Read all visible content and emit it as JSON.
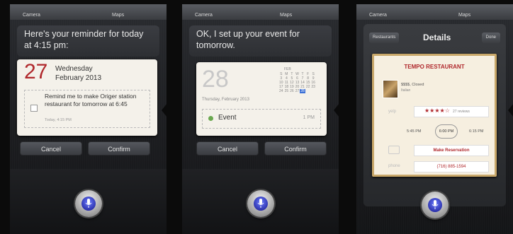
{
  "panels": [
    {
      "top_left": "Camera",
      "top_right": "Maps",
      "bubble": "Here's your reminder for today at 4:15 pm:",
      "card": {
        "day": "27",
        "weekday": "Wednesday",
        "month_year": "February 2013",
        "reminder_text": "Remind me to make Origer station restaurant for tomorrow at 6:45",
        "reminder_time": "Today, 4:15 PM"
      },
      "cancel": "Cancel",
      "confirm": "Confirm"
    },
    {
      "top_left": "Camera",
      "top_right": "Maps",
      "bubble": "OK, I set up your event for tomorrow.",
      "card": {
        "day": "28",
        "date_line": "Thursday, February 2013",
        "month_abbr": "FEB",
        "cal_header": [
          "S",
          "M",
          "T",
          "W",
          "T",
          "F",
          "S"
        ],
        "cal_rows": [
          [
            "3",
            "4",
            "5",
            "6",
            "7",
            "8",
            "9"
          ],
          [
            "10",
            "11",
            "12",
            "13",
            "14",
            "15",
            "16"
          ],
          [
            "17",
            "18",
            "19",
            "20",
            "21",
            "22",
            "23"
          ],
          [
            "24",
            "25",
            "26",
            "27",
            "28",
            "",
            ""
          ]
        ],
        "event_name": "Event",
        "event_time": "1 PM"
      },
      "cancel": "Cancel",
      "confirm": "Confirm"
    },
    {
      "top_left": "Camera",
      "top_right": "Maps",
      "nav": {
        "back": "Restaurants",
        "title": "Details",
        "done": "Done"
      },
      "restaurant": {
        "name": "TEMPO RESTAURANT",
        "price_status": "$$$$, Closed",
        "cuisine": "Italian",
        "yelp_label": "yelp",
        "stars": "★★★★☆",
        "reviews": "27 reviews",
        "times": [
          "5:45 PM",
          "6:00 PM",
          "6:15 PM"
        ],
        "reserve_label": "Make Reservation",
        "phone_label": "phone",
        "phone": "(716) 885-1594"
      }
    }
  ],
  "colors": {
    "accent_red": "#b0282c",
    "event_green": "#6aa84f",
    "siri_blue": "#3a46d6"
  }
}
